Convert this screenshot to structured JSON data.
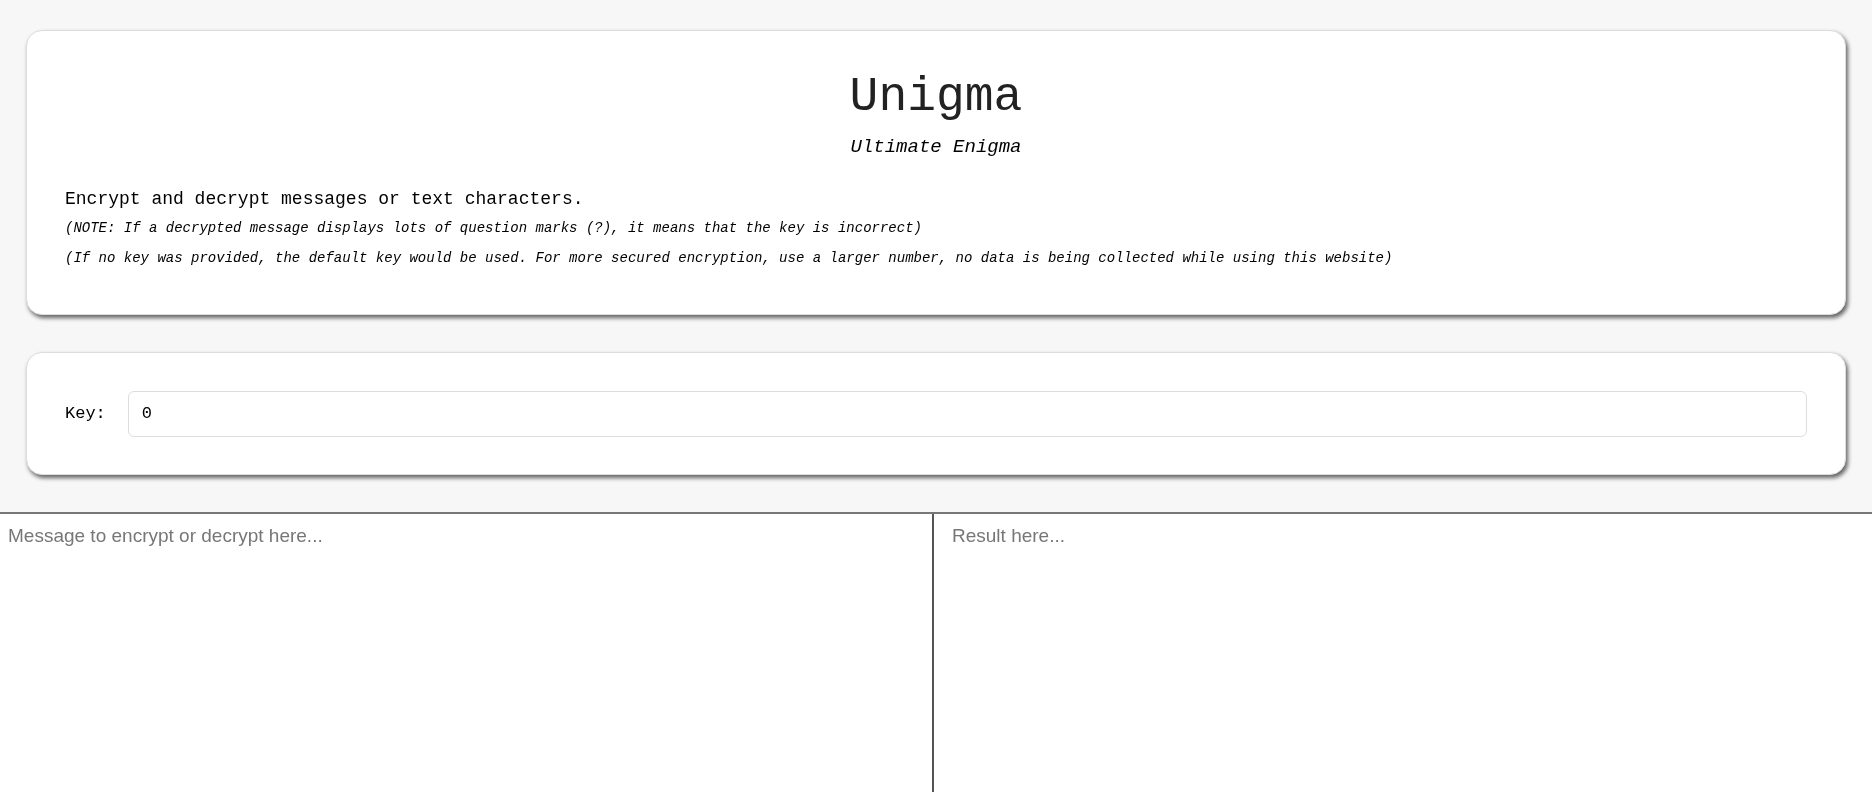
{
  "header": {
    "title": "Unigma",
    "subtitle": "Ultimate Enigma",
    "description": "Encrypt and decrypt messages or text characters.",
    "notes": [
      "(NOTE: If a decrypted message displays lots of question marks (?), it means that the key is incorrect)",
      "(If no key was provided, the default key would be used. For more secured encryption, use a larger number, no data is being collected while using this website)"
    ]
  },
  "key": {
    "label": "Key:",
    "value": "0"
  },
  "message": {
    "placeholder": "Message to encrypt or decrypt here..."
  },
  "result": {
    "placeholder": "Result here..."
  }
}
